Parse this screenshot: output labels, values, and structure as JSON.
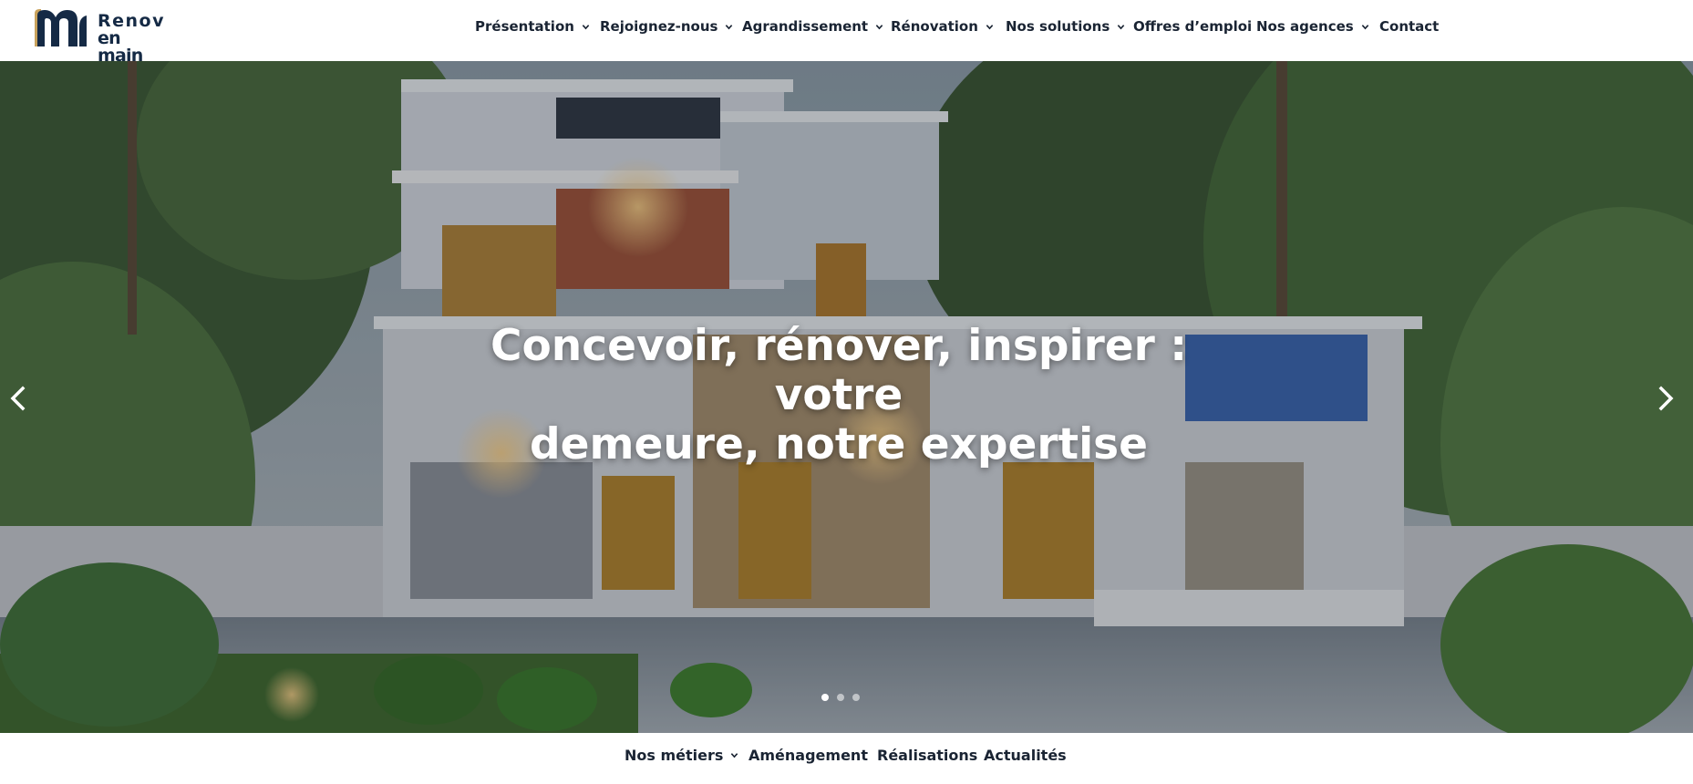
{
  "brand": {
    "name_line1": "Renov",
    "name_line2": "en main",
    "logo_color": "#152a45",
    "logo_accent": "#c9a25c"
  },
  "main_nav": {
    "items": [
      {
        "label": "Présentation",
        "has_dropdown": true
      },
      {
        "label": "Rejoignez-nous",
        "has_dropdown": true
      },
      {
        "label": "Agrandissement",
        "has_dropdown": true
      },
      {
        "label": "Rénovation",
        "has_dropdown": true
      },
      {
        "label": "Nos solutions",
        "has_dropdown": true
      },
      {
        "label": "Offres d’emploi",
        "has_dropdown": false
      },
      {
        "label": "Nos agences",
        "has_dropdown": true
      },
      {
        "label": "Contact",
        "has_dropdown": false
      }
    ]
  },
  "hero": {
    "title_line1": "Concevoir, rénover, inspirer : votre",
    "title_line2": "demeure, notre expertise",
    "prev_icon": "chevron-left-icon",
    "next_icon": "chevron-right-icon",
    "slides_count": 3,
    "active_slide": 1
  },
  "sub_nav": {
    "items": [
      {
        "label": "Nos métiers",
        "has_dropdown": true
      },
      {
        "label": "Aménagement",
        "has_dropdown": false
      },
      {
        "label": "Réalisations",
        "has_dropdown": false
      },
      {
        "label": "Actualités",
        "has_dropdown": false
      }
    ]
  },
  "colors": {
    "text": "#1a2433",
    "hero_title": "#ffffff"
  }
}
